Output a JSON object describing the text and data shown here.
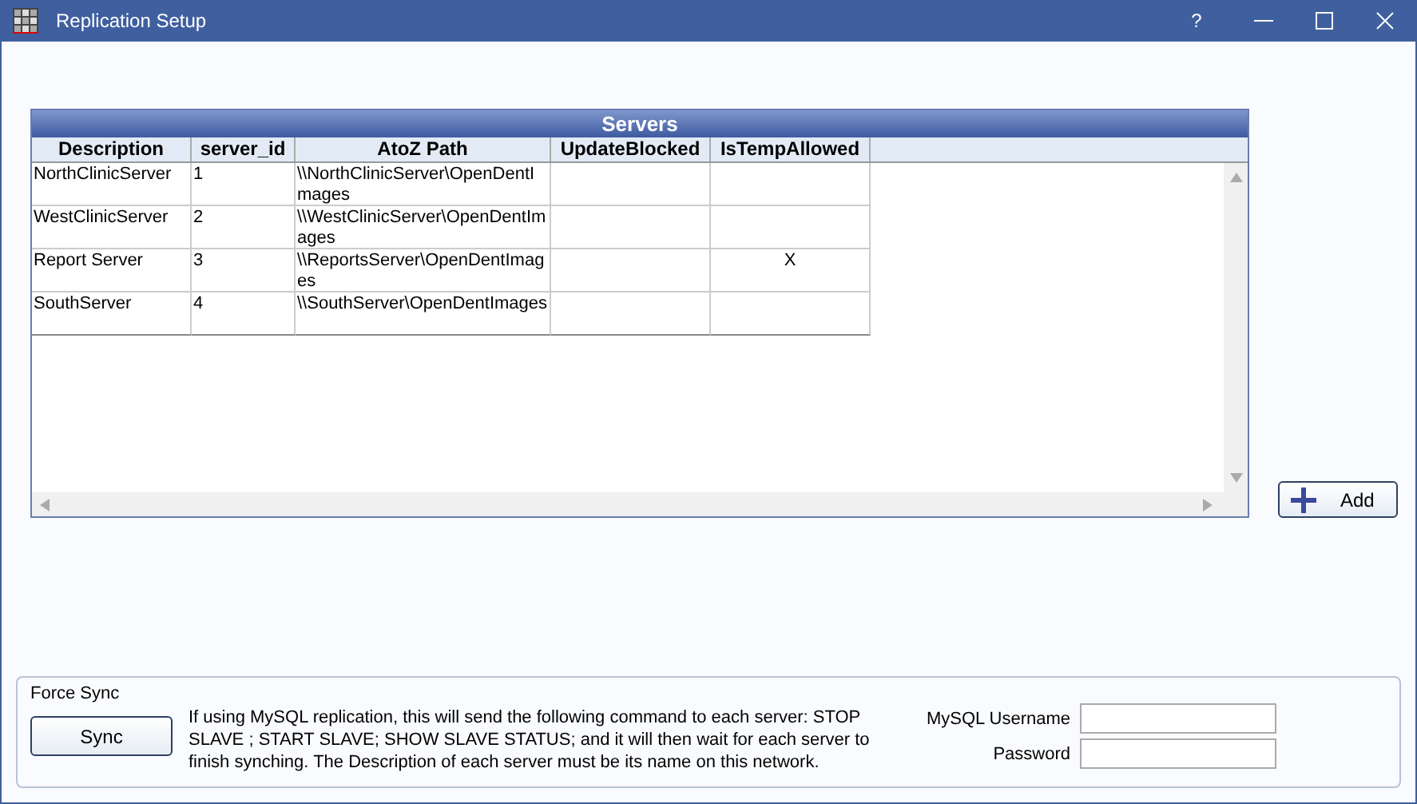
{
  "window": {
    "title": "Replication Setup",
    "controls": [
      "?"
    ]
  },
  "grid": {
    "title": "Servers",
    "columns": [
      "Description",
      "server_id",
      "AtoZ Path",
      "UpdateBlocked",
      "IsTempAllowed"
    ],
    "rows": [
      {
        "description": "NorthClinicServer",
        "server_id": "1",
        "atoz_path": "\\\\NorthClinicServer\\OpenDentImages"
      },
      {
        "description": "WestClinicServer",
        "server_id": "2",
        "atoz_path": "\\\\WestClinicServer\\OpenDentImages"
      },
      {
        "description": "Report Server",
        "server_id": "3",
        "atoz_path": "\\\\ReportsServer\\OpenDentImages",
        "is_temp_allowed": "X"
      },
      {
        "description": "SouthServer",
        "server_id": "4",
        "atoz_path": "\\\\SouthServer\\OpenDentImages"
      }
    ]
  },
  "add_button": "Add",
  "force_sync": {
    "title": "Force Sync",
    "button": "Sync",
    "description": "If using MySQL replication, this will send the following command to each server:  STOP SLAVE ; START SLAVE; SHOW SLAVE STATUS; and it will then wait for each server to finish synching.  The Description of each server must be its name on this network.",
    "fields": [
      {
        "label": "MySQL Username"
      },
      {
        "label": "Password"
      }
    ]
  }
}
